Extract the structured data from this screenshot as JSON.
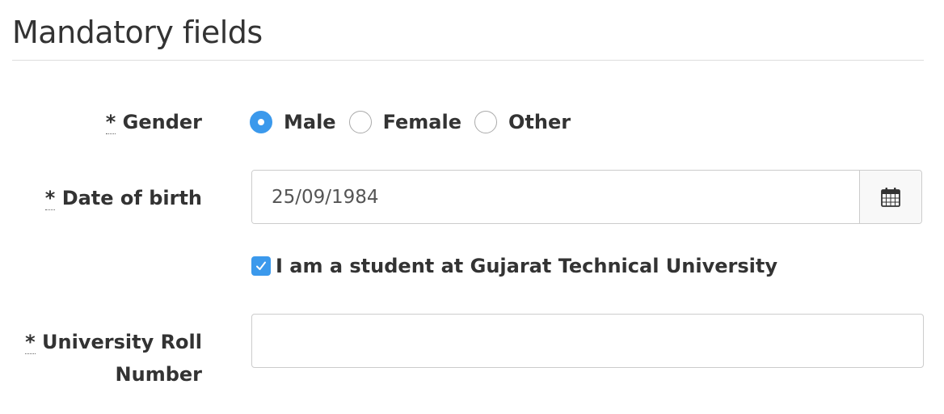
{
  "section": {
    "title": "Mandatory fields"
  },
  "required_marker": "*",
  "gender": {
    "label": "Gender",
    "options": [
      {
        "label": "Male",
        "checked": true
      },
      {
        "label": "Female",
        "checked": false
      },
      {
        "label": "Other",
        "checked": false
      }
    ]
  },
  "dob": {
    "label": "Date of birth",
    "value": "25/09/1984",
    "icon": "calendar-icon"
  },
  "student": {
    "label": "I am a student at Gujarat Technical University",
    "checked": true
  },
  "roll_number": {
    "label_line1": "University Roll",
    "label_line2": "Number",
    "value": ""
  },
  "colors": {
    "accent": "#3b99ec",
    "text": "#333333",
    "border": "#cccccc"
  }
}
